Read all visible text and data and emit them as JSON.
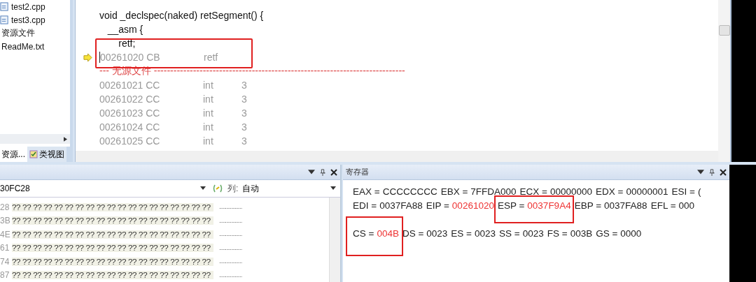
{
  "solution_tree": {
    "items": [
      {
        "label": "test2.cpp",
        "kind": "file"
      },
      {
        "label": "test3.cpp",
        "kind": "file"
      },
      {
        "label": "资源文件",
        "kind": "folder"
      },
      {
        "label": "ReadMe.txt",
        "kind": "plain"
      }
    ]
  },
  "left_tabs": [
    {
      "label": "资源...",
      "selected": true,
      "kind": "plain"
    },
    {
      "label": "类视图",
      "selected": false,
      "kind": "icon"
    }
  ],
  "editor": {
    "lines": [
      {
        "kind": "source",
        "text": "void _declspec(naked) retSegment() {"
      },
      {
        "kind": "source",
        "text": "   __asm {"
      },
      {
        "kind": "source",
        "text": "       retf;"
      },
      {
        "kind": "asm",
        "address": "00261020 CB",
        "mnemonic": "retf",
        "current": true
      },
      {
        "kind": "separator",
        "text": "--- 无源文件 -----------------------------------------------------------------------------"
      },
      {
        "kind": "asm",
        "address": "00261021 CC",
        "mnemonic": "int",
        "operand": "3",
        "current": false
      },
      {
        "kind": "asm",
        "address": "00261022 CC",
        "mnemonic": "int",
        "operand": "3",
        "current": false
      },
      {
        "kind": "asm",
        "address": "00261023 CC",
        "mnemonic": "int",
        "operand": "3",
        "current": false
      },
      {
        "kind": "asm",
        "address": "00261024 CC",
        "mnemonic": "int",
        "operand": "3",
        "current": false
      },
      {
        "kind": "asm",
        "address": "00261025 CC",
        "mnemonic": "int",
        "operand": "3",
        "current": false
      }
    ]
  },
  "memory": {
    "address": "30FC28",
    "columns_label": "列:",
    "columns_value": "自动",
    "rows": [
      {
        "address": "28",
        "bytes": "?? ?? ?? ?? ?? ?? ?? ?? ?? ?? ?? ?? ?? ?? ?? ?? ?? ?? ??",
        "ascii": "..................."
      },
      {
        "address": "3B",
        "bytes": "?? ?? ?? ?? ?? ?? ?? ?? ?? ?? ?? ?? ?? ?? ?? ?? ?? ?? ??",
        "ascii": "..................."
      },
      {
        "address": "4E",
        "bytes": "?? ?? ?? ?? ?? ?? ?? ?? ?? ?? ?? ?? ?? ?? ?? ?? ?? ?? ??",
        "ascii": "..................."
      },
      {
        "address": "61",
        "bytes": "?? ?? ?? ?? ?? ?? ?? ?? ?? ?? ?? ?? ?? ?? ?? ?? ?? ?? ??",
        "ascii": "..................."
      },
      {
        "address": "74",
        "bytes": "?? ?? ?? ?? ?? ?? ?? ?? ?? ?? ?? ?? ?? ?? ?? ?? ?? ?? ??",
        "ascii": "..................."
      },
      {
        "address": "87",
        "bytes": "?? ?? ?? ?? ?? ?? ?? ?? ?? ?? ?? ?? ?? ?? ?? ?? ?? ?? ??",
        "ascii": "..................."
      }
    ]
  },
  "registers": {
    "title": "寄存器",
    "lines": [
      [
        {
          "name": "EAX =",
          "value": "CCCCCCCC",
          "changed": false
        },
        {
          "name": "EBX =",
          "value": "7FFDA000",
          "changed": false
        },
        {
          "name": "ECX =",
          "value": "00000000",
          "changed": false
        },
        {
          "name": "EDX =",
          "value": "00000001",
          "changed": false
        },
        {
          "name": "ESI =",
          "value": "(",
          "changed": false
        }
      ],
      [
        {
          "name": "EDI =",
          "value": "0037FA88",
          "changed": false
        },
        {
          "name": "EIP =",
          "value": "00261020",
          "changed": true
        },
        {
          "name": "ESP =",
          "value": "0037F9A4",
          "changed": true
        },
        {
          "name": "EBP =",
          "value": "0037FA88",
          "changed": false
        },
        {
          "name": "EFL =",
          "value": "000",
          "changed": false
        }
      ],
      [
        {
          "name": "CS =",
          "value": "004B",
          "changed": true
        },
        {
          "name": "DS =",
          "value": "0023",
          "changed": false
        },
        {
          "name": "ES =",
          "value": "0023",
          "changed": false
        },
        {
          "name": "SS =",
          "value": "0023",
          "changed": false
        },
        {
          "name": "FS =",
          "value": "003B",
          "changed": false
        },
        {
          "name": "GS =",
          "value": "0000",
          "changed": false
        }
      ]
    ]
  }
}
